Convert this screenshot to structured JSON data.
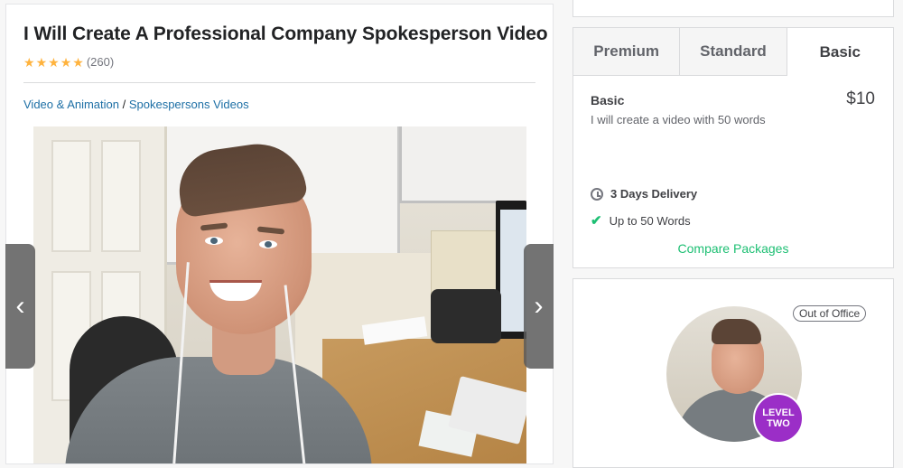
{
  "gig": {
    "title": "I Will Create A Professional Company Spokesperson Video",
    "rating_count": "(260)",
    "stars": 5,
    "breadcrumb": {
      "category": "Video & Animation",
      "separator": " / ",
      "subcategory": "Spokespersons Videos"
    }
  },
  "gallery": {
    "prev_icon": "‹",
    "next_icon": "›"
  },
  "packages": {
    "tabs": [
      {
        "label": "Premium",
        "active": false
      },
      {
        "label": "Standard",
        "active": false
      },
      {
        "label": "Basic",
        "active": true
      }
    ],
    "selected": {
      "name": "Basic",
      "price": "$10",
      "description": "I will create a video with 50 words",
      "delivery": "3 Days Delivery",
      "features": [
        "Up to 50 Words"
      ]
    },
    "compare_label": "Compare Packages"
  },
  "seller": {
    "status": "Out of Office",
    "level_badge_line1": "LEVEL",
    "level_badge_line2": "TWO"
  },
  "colors": {
    "accent_green": "#1dbf73",
    "link_blue": "#1d6fa5",
    "star": "#ffb33e",
    "badge_purple": "#9b2ec7"
  }
}
